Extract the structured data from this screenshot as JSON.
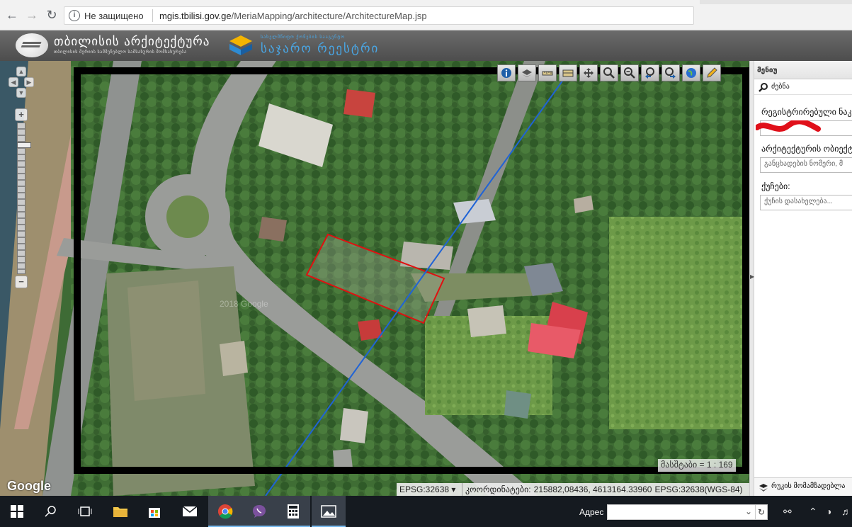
{
  "browser": {
    "security_label": "Не защищено",
    "url_host": "mgis.tbilisi.gov.ge",
    "url_path": "/MeriaMapping/architecture/ArchitectureMap.jsp",
    "back_icon": "arrow-left-icon",
    "forward_icon": "arrow-right-icon",
    "reload_icon": "reload-icon"
  },
  "header": {
    "logo_title": "თბილისის არქიტექტურა",
    "logo_subtitle": "თბილისის მერიის სამშენებლო სამსახურის მომსახურება",
    "registry_subtitle": "სახელმწიფო ქონების სააგენტო",
    "registry_title": "საჯარო რეესტრი"
  },
  "map": {
    "toolbar_icons": [
      "info-icon",
      "layers-icon",
      "ruler-icon",
      "measure-area-icon",
      "pan-icon",
      "zoom-in-icon",
      "zoom-out-icon",
      "zoom-previous-icon",
      "zoom-next-icon",
      "globe-icon",
      "edit-icon"
    ],
    "google_label": "Google",
    "scale_text": "მასშტაბი = 1 : 169",
    "projection_select": "EPSG:32638",
    "coords_label": "კოორდინატები:",
    "coords_value": "215882,08436, 4613164.33960",
    "coords_projection": "EPSG:32638(WGS-84)",
    "watermark": "2018 Google"
  },
  "side": {
    "menu_title": "მენიუ",
    "search_label": "ძებნა",
    "registered_label": "რეგისტრირებული ნაკვ",
    "architectural_label": "არქიტექტურის ობიექტ",
    "architectural_placeholder": "განცხადების ნომერი, მ",
    "streets_label": "ქუჩები:",
    "streets_placeholder": "ქუჩის დასახელება...",
    "footer_label": "რუკის მომამზადებლა"
  },
  "taskbar": {
    "address_label": "Адрес",
    "apps": [
      "start-icon",
      "search-icon",
      "task-view-icon",
      "file-explorer-icon",
      "store-icon",
      "mail-icon",
      "chrome-icon",
      "viber-icon",
      "calculator-icon",
      "photos-icon"
    ]
  }
}
